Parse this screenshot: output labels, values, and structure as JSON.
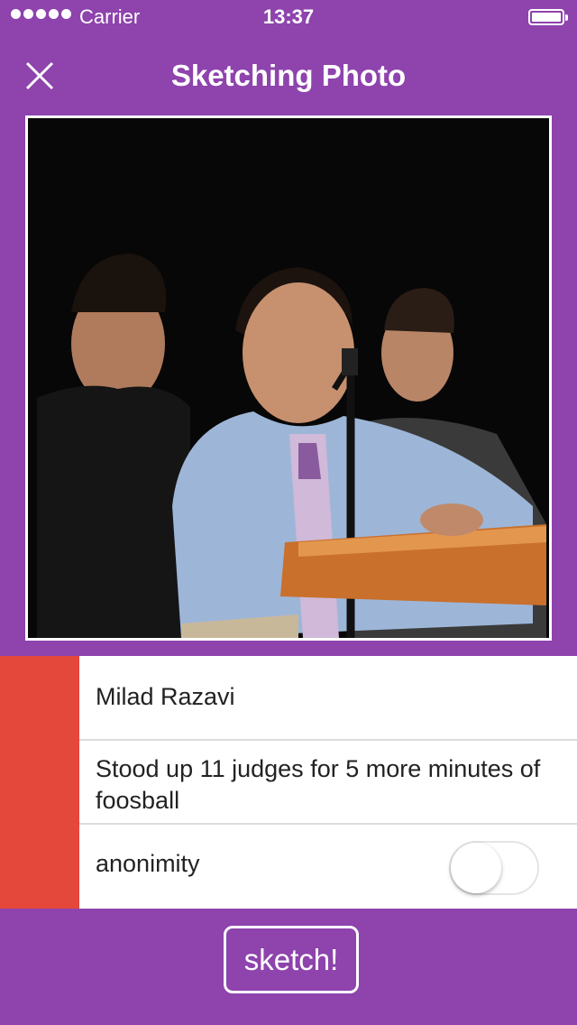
{
  "status_bar": {
    "carrier": "Carrier",
    "time": "13:37",
    "battery_level": 1.0
  },
  "nav": {
    "title": "Sketching Photo",
    "close_icon": "close-icon"
  },
  "photo": {
    "background_color": "#070707"
  },
  "form": {
    "name": "Milad Razavi",
    "description": "Stood up 11 judges for 5 more minutes of foosball",
    "anonymity_label": "anonimity",
    "anonymity_on": false
  },
  "actions": {
    "sketch_label": "sketch!"
  },
  "colors": {
    "background": "#8e43ad",
    "accent": "#e3483a",
    "field_background": "#ffffff"
  }
}
